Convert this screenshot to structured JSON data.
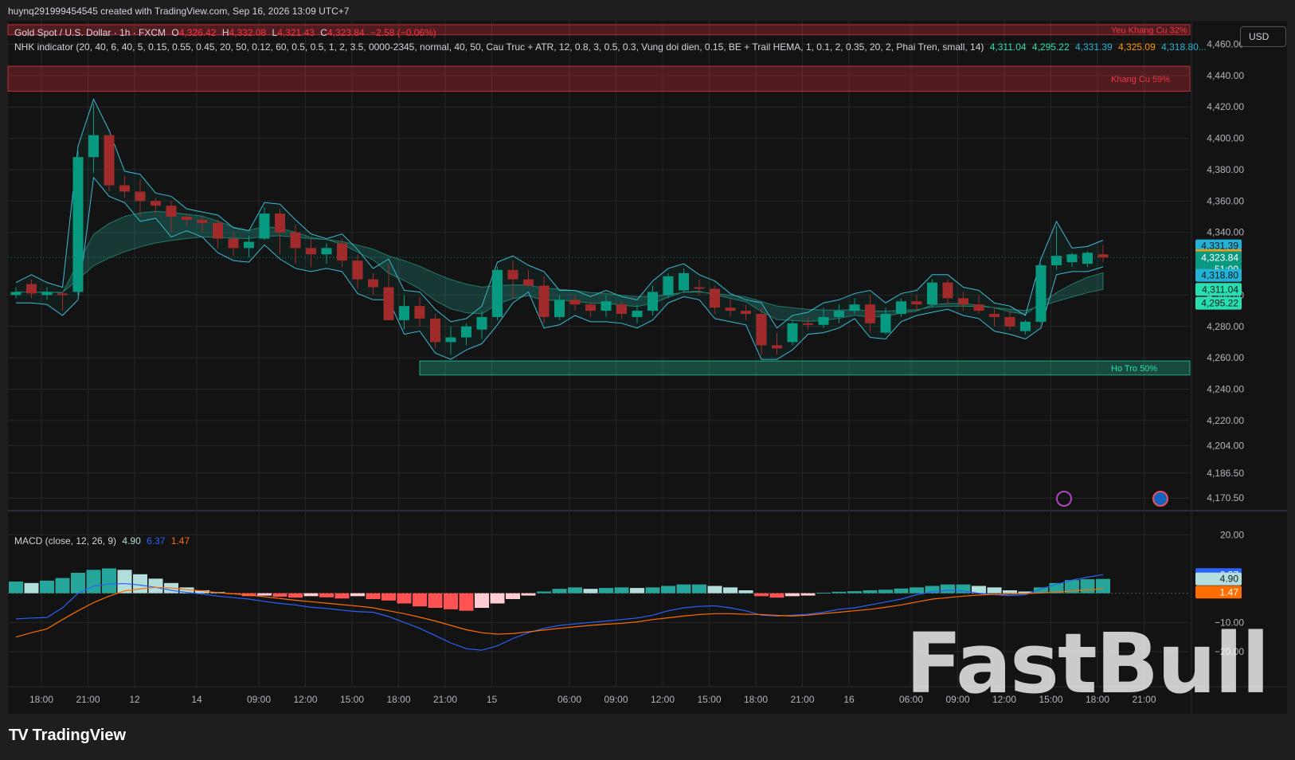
{
  "header": {
    "byline": "huynq291999454545 created with TradingView.com, Sep 16, 2026 13:09 UTC+7",
    "currency_button": "USD"
  },
  "symbol_legend": {
    "name": "Gold Spot / U.S. Dollar · 1h · FXCM",
    "o_label": "O",
    "o": "4,326.42",
    "h_label": "H",
    "h": "4,332.08",
    "l_label": "L",
    "l": "4,321.43",
    "c_label": "C",
    "c": "4,323.84",
    "chg": "−2.58 (−0.06%)"
  },
  "indicator_legend": {
    "text": "NHK indicator (20, 40, 6, 40, 5, 0.15, 0.55, 0.45, 20, 50, 0.12, 60, 0.5, 0.5, 1, 2, 3.5, 0000-2345, normal, 40, 50, Cau Truc + ATR, 12, 0.8, 3, 0.5, 0.3, Vung doi dien, 0.15, BE + Trail HEMA, 1, 0.1, 2, 0.35, 20, 2, Phai Tren, small, 14)",
    "values": [
      {
        "text": "4,311.04",
        "color": "#26e0b0"
      },
      {
        "text": "4,295.22",
        "color": "#26e0b0"
      },
      {
        "text": "4,331.39",
        "color": "#22b3d6"
      },
      {
        "text": "4,325.09",
        "color": "#ff9800"
      },
      {
        "text": "4,318.80...",
        "color": "#22b3d6"
      }
    ]
  },
  "macd_legend": {
    "name": "MACD (close, 12, 26, 9)",
    "v1": "4.90",
    "v2": "6.37",
    "v3": "1.47"
  },
  "zones": [
    {
      "label": "Yeu Khang Cu 32%",
      "top": 4472.5,
      "bottom": 4466,
      "color": "#f23645",
      "start_index": 0
    },
    {
      "label": "Khang Cu 59%",
      "top": 4446,
      "bottom": 4430,
      "color": "#f23645",
      "start_index": 0
    },
    {
      "label": "Ho Tro 50%",
      "top": 4258,
      "bottom": 4249,
      "color": "#26e0b0",
      "start_index": 26
    }
  ],
  "price_labels": [
    {
      "text": "4,331.39",
      "value": 4331.39,
      "bg": "#22b3d6",
      "fg": "#131722"
    },
    {
      "text": "4,325.09",
      "value": 4325.09,
      "bg": "#ff9800",
      "fg": "#131722"
    },
    {
      "text": "4,323.84",
      "value": 4323.84,
      "bg": "#089981",
      "fg": "#ffffff"
    },
    {
      "text": "51:00",
      "value": 4316.4,
      "bg": "#089981",
      "fg": "#ffffff"
    },
    {
      "text": "4,318.80",
      "value": 4312.6,
      "bg": "#22b3d6",
      "fg": "#131722"
    },
    {
      "text": "4,311.04",
      "value": 4303.6,
      "bg": "#26e0b0",
      "fg": "#131722"
    },
    {
      "text": "4,295.22",
      "value": 4294.8,
      "bg": "#26e0b0",
      "fg": "#131722"
    }
  ],
  "macd_labels": [
    {
      "text": "6.37",
      "value": 6.37,
      "bg": "#2962ff",
      "fg": "#ffffff"
    },
    {
      "text": "4.90",
      "value": 4.9,
      "bg": "#b2dfdb",
      "fg": "#131722"
    },
    {
      "text": "1.47",
      "value": 1.47,
      "bg": "#ff6d00",
      "fg": "#ffffff"
    }
  ],
  "watermark": "FastBull",
  "footer": {
    "logo": "TV",
    "brand": "TradingView"
  },
  "chart_data": [
    {
      "type": "candlestick",
      "title": "Gold Spot / U.S. Dollar · 1h · FXCM",
      "y_tick_labels": [
        {
          "text": "4,460.00",
          "value": 4460
        },
        {
          "text": "4,440.00",
          "value": 4440
        },
        {
          "text": "4,420.00",
          "value": 4420
        },
        {
          "text": "4,400.00",
          "value": 4400
        },
        {
          "text": "4,380.00",
          "value": 4380
        },
        {
          "text": "4,360.00",
          "value": 4360
        },
        {
          "text": "4,340.00",
          "value": 4340
        },
        {
          "text": "4,300.00",
          "value": 4300
        },
        {
          "text": "4,280.00",
          "value": 4280
        },
        {
          "text": "4,260.00",
          "value": 4260
        },
        {
          "text": "4,240.00",
          "value": 4240
        },
        {
          "text": "4,220.00",
          "value": 4220
        },
        {
          "text": "4,204.00",
          "value": 4204
        },
        {
          "text": "4,186.50",
          "value": 4186.5
        },
        {
          "text": "4,170.50",
          "value": 4170.5
        }
      ],
      "x_tick_labels": [
        "18:00",
        "21:00",
        "12",
        "14",
        "09:00",
        "12:00",
        "15:00",
        "18:00",
        "21:00",
        "15",
        "06:00",
        "09:00",
        "12:00",
        "15:00",
        "18:00",
        "21:00",
        "16",
        "06:00",
        "09:00",
        "12:00",
        "15:00",
        "18:00",
        "21:00"
      ],
      "ylim": [
        4163,
        4475
      ],
      "grid": true,
      "candles": [
        {
          "o": 4300,
          "h": 4305,
          "l": 4298,
          "c": 4302
        },
        {
          "o": 4307,
          "h": 4310,
          "l": 4298,
          "c": 4301
        },
        {
          "o": 4300,
          "h": 4305,
          "l": 4297,
          "c": 4302
        },
        {
          "o": 4301,
          "h": 4302,
          "l": 4290,
          "c": 4300
        },
        {
          "o": 4302,
          "h": 4392,
          "l": 4300,
          "c": 4388
        },
        {
          "o": 4388,
          "h": 4422,
          "l": 4378,
          "c": 4402
        },
        {
          "o": 4402,
          "h": 4402,
          "l": 4366,
          "c": 4370
        },
        {
          "o": 4370,
          "h": 4376,
          "l": 4362,
          "c": 4366
        },
        {
          "o": 4366,
          "h": 4374,
          "l": 4350,
          "c": 4360
        },
        {
          "o": 4360,
          "h": 4362,
          "l": 4352,
          "c": 4357
        },
        {
          "o": 4357,
          "h": 4360,
          "l": 4340,
          "c": 4350
        },
        {
          "o": 4350,
          "h": 4352,
          "l": 4344,
          "c": 4348
        },
        {
          "o": 4348,
          "h": 4350,
          "l": 4340,
          "c": 4346
        },
        {
          "o": 4346,
          "h": 4348,
          "l": 4330,
          "c": 4336
        },
        {
          "o": 4336,
          "h": 4340,
          "l": 4325,
          "c": 4330
        },
        {
          "o": 4330,
          "h": 4338,
          "l": 4324,
          "c": 4334
        },
        {
          "o": 4336,
          "h": 4356,
          "l": 4335,
          "c": 4352
        },
        {
          "o": 4352,
          "h": 4355,
          "l": 4326,
          "c": 4340
        },
        {
          "o": 4340,
          "h": 4345,
          "l": 4320,
          "c": 4330
        },
        {
          "o": 4330,
          "h": 4336,
          "l": 4318,
          "c": 4326
        },
        {
          "o": 4326,
          "h": 4333,
          "l": 4320,
          "c": 4330
        },
        {
          "o": 4333,
          "h": 4336,
          "l": 4318,
          "c": 4322
        },
        {
          "o": 4322,
          "h": 4326,
          "l": 4304,
          "c": 4310
        },
        {
          "o": 4310,
          "h": 4314,
          "l": 4300,
          "c": 4305
        },
        {
          "o": 4305,
          "h": 4320,
          "l": 4300,
          "c": 4284
        },
        {
          "o": 4284,
          "h": 4300,
          "l": 4278,
          "c": 4293
        },
        {
          "o": 4293,
          "h": 4299,
          "l": 4280,
          "c": 4285
        },
        {
          "o": 4285,
          "h": 4288,
          "l": 4266,
          "c": 4270
        },
        {
          "o": 4270,
          "h": 4280,
          "l": 4262,
          "c": 4273
        },
        {
          "o": 4273,
          "h": 4282,
          "l": 4268,
          "c": 4280
        },
        {
          "o": 4278,
          "h": 4290,
          "l": 4272,
          "c": 4286
        },
        {
          "o": 4286,
          "h": 4318,
          "l": 4284,
          "c": 4316
        },
        {
          "o": 4316,
          "h": 4322,
          "l": 4298,
          "c": 4310
        },
        {
          "o": 4310,
          "h": 4316,
          "l": 4305,
          "c": 4306
        },
        {
          "o": 4306,
          "h": 4312,
          "l": 4282,
          "c": 4286
        },
        {
          "o": 4286,
          "h": 4300,
          "l": 4284,
          "c": 4297
        },
        {
          "o": 4297,
          "h": 4300,
          "l": 4290,
          "c": 4294
        },
        {
          "o": 4294,
          "h": 4296,
          "l": 4286,
          "c": 4290
        },
        {
          "o": 4290,
          "h": 4300,
          "l": 4286,
          "c": 4296
        },
        {
          "o": 4294,
          "h": 4296,
          "l": 4285,
          "c": 4288
        },
        {
          "o": 4286,
          "h": 4294,
          "l": 4282,
          "c": 4290
        },
        {
          "o": 4290,
          "h": 4306,
          "l": 4287,
          "c": 4302
        },
        {
          "o": 4300,
          "h": 4314,
          "l": 4298,
          "c": 4312
        },
        {
          "o": 4303,
          "h": 4317,
          "l": 4302,
          "c": 4314
        },
        {
          "o": 4305,
          "h": 4310,
          "l": 4300,
          "c": 4304
        },
        {
          "o": 4304,
          "h": 4306,
          "l": 4288,
          "c": 4292
        },
        {
          "o": 4292,
          "h": 4298,
          "l": 4286,
          "c": 4290
        },
        {
          "o": 4290,
          "h": 4294,
          "l": 4284,
          "c": 4288
        },
        {
          "o": 4288,
          "h": 4292,
          "l": 4262,
          "c": 4268
        },
        {
          "o": 4268,
          "h": 4276,
          "l": 4262,
          "c": 4266
        },
        {
          "o": 4270,
          "h": 4284,
          "l": 4268,
          "c": 4282
        },
        {
          "o": 4282,
          "h": 4286,
          "l": 4278,
          "c": 4281
        },
        {
          "o": 4281,
          "h": 4292,
          "l": 4279,
          "c": 4286
        },
        {
          "o": 4286,
          "h": 4294,
          "l": 4282,
          "c": 4290
        },
        {
          "o": 4290,
          "h": 4298,
          "l": 4288,
          "c": 4294
        },
        {
          "o": 4294,
          "h": 4300,
          "l": 4276,
          "c": 4282
        },
        {
          "o": 4276,
          "h": 4292,
          "l": 4275,
          "c": 4288
        },
        {
          "o": 4288,
          "h": 4298,
          "l": 4286,
          "c": 4296
        },
        {
          "o": 4296,
          "h": 4300,
          "l": 4290,
          "c": 4294
        },
        {
          "o": 4294,
          "h": 4310,
          "l": 4292,
          "c": 4308
        },
        {
          "o": 4308,
          "h": 4310,
          "l": 4294,
          "c": 4298
        },
        {
          "o": 4298,
          "h": 4302,
          "l": 4290,
          "c": 4294
        },
        {
          "o": 4294,
          "h": 4300,
          "l": 4288,
          "c": 4290
        },
        {
          "o": 4288,
          "h": 4292,
          "l": 4280,
          "c": 4286
        },
        {
          "o": 4286,
          "h": 4290,
          "l": 4278,
          "c": 4280
        },
        {
          "o": 4277,
          "h": 4284,
          "l": 4275,
          "c": 4283
        },
        {
          "o": 4283,
          "h": 4320,
          "l": 4282,
          "c": 4319
        },
        {
          "o": 4319,
          "h": 4344,
          "l": 4316,
          "c": 4325
        },
        {
          "o": 4321,
          "h": 4327,
          "l": 4318,
          "c": 4326
        },
        {
          "o": 4320,
          "h": 4328,
          "l": 4318,
          "c": 4327
        },
        {
          "o": 4326,
          "h": 4332,
          "l": 4321,
          "c": 4324
        }
      ],
      "up_color": "#089981",
      "down_color": "#a12a2a",
      "flat_color": "#5d606b"
    },
    {
      "type": "bar",
      "title": "MACD (close, 12, 26, 9)",
      "y_tick_labels": [
        {
          "text": "20.00",
          "value": 20
        },
        {
          "text": "−10.00",
          "value": -10
        },
        {
          "text": "−20.00",
          "value": -20
        }
      ],
      "ylim": [
        -32,
        28
      ],
      "histogram": [
        4.0,
        3.5,
        4.3,
        5.2,
        7.0,
        8.0,
        8.5,
        8.0,
        6.5,
        5.0,
        3.5,
        2.0,
        1.0,
        0.4,
        -0.3,
        -1.0,
        -0.8,
        -1.2,
        -1.5,
        -1.0,
        -1.4,
        -1.8,
        -1.0,
        -2.0,
        -2.5,
        -3.5,
        -4.5,
        -5.0,
        -5.5,
        -6.0,
        -5.0,
        -3.5,
        -2.0,
        -0.8,
        0.6,
        1.5,
        2.0,
        1.5,
        1.8,
        2.0,
        1.8,
        2.0,
        2.5,
        3.0,
        3.0,
        2.5,
        2.0,
        1.0,
        -1.0,
        -1.5,
        -1.0,
        -0.8,
        0.2,
        0.5,
        0.7,
        1.0,
        1.2,
        1.6,
        2.0,
        2.5,
        3.0,
        3.0,
        2.5,
        2.0,
        1.0,
        0.6,
        2.0,
        3.5,
        4.5,
        4.8,
        4.9
      ],
      "macd_line": [
        -8.8,
        -8.5,
        -8.3,
        -5.0,
        0.0,
        2.4,
        3.2,
        3.3,
        2.8,
        2.0,
        1.0,
        0.3,
        -0.3,
        -1.0,
        -1.5,
        -2.0,
        -2.8,
        -3.5,
        -4.0,
        -4.8,
        -5.2,
        -5.8,
        -6.3,
        -6.5,
        -8.0,
        -10.0,
        -12.0,
        -14.5,
        -17.0,
        -19.0,
        -19.5,
        -18.0,
        -15.5,
        -13.5,
        -12.0,
        -11.0,
        -10.5,
        -10.0,
        -9.5,
        -9.0,
        -8.5,
        -7.5,
        -6.0,
        -5.0,
        -4.5,
        -4.3,
        -5.0,
        -6.0,
        -7.5,
        -7.8,
        -7.5,
        -7.2,
        -6.5,
        -5.5,
        -5.0,
        -4.0,
        -3.0,
        -2.0,
        -0.5,
        0.5,
        1.0,
        0.8,
        0.0,
        -0.5,
        -0.8,
        -0.5,
        1.5,
        3.0,
        4.5,
        5.5,
        6.37
      ],
      "signal_line": [
        -15.0,
        -13.5,
        -12.2,
        -9.0,
        -6.0,
        -3.2,
        -1.0,
        0.8,
        1.5,
        2.0,
        1.8,
        1.2,
        0.8,
        0.2,
        -0.2,
        -0.6,
        -1.2,
        -1.8,
        -2.4,
        -2.9,
        -3.4,
        -3.9,
        -4.4,
        -5.0,
        -6.0,
        -7.0,
        -8.2,
        -9.5,
        -11.0,
        -12.5,
        -13.5,
        -14.0,
        -13.8,
        -13.2,
        -12.6,
        -12.0,
        -11.5,
        -11.0,
        -10.6,
        -10.3,
        -9.8,
        -9.0,
        -8.4,
        -7.8,
        -7.3,
        -7.0,
        -7.0,
        -7.2,
        -7.3,
        -7.6,
        -7.8,
        -7.5,
        -7.0,
        -6.5,
        -6.0,
        -5.5,
        -4.8,
        -4.0,
        -3.0,
        -2.0,
        -1.5,
        -1.0,
        -0.6,
        -0.4,
        -0.3,
        -0.1,
        0.1,
        0.4,
        0.8,
        1.2,
        1.47
      ],
      "macd_color": "#2962ff",
      "signal_color": "#ff6d00"
    }
  ]
}
